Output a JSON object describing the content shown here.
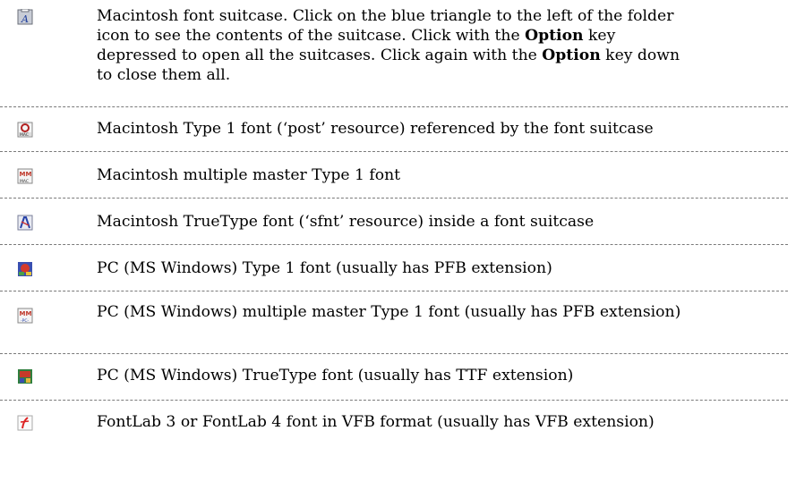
{
  "rows": [
    {
      "icon": "font-suitcase-icon",
      "text_parts": [
        {
          "t": "Macintosh font suitcase. Click on the blue triangle to the left of the folder icon to see the contents of the suitcase. Click with the "
        },
        {
          "t": "Option",
          "bold": true
        },
        {
          "t": " key depressed to open all the suitcases. Click again with the "
        },
        {
          "t": "Option",
          "bold": true
        },
        {
          "t": " key down to close them all."
        }
      ]
    },
    {
      "icon": "mac-type1-font-icon",
      "text": "Macintosh Type 1 font (‘post’ resource) referenced by the font suitcase"
    },
    {
      "icon": "mac-multiple-master-font-icon",
      "text": "Macintosh multiple master Type 1 font"
    },
    {
      "icon": "mac-truetype-font-icon",
      "text": "Macintosh TrueType font (‘sfnt’ resource) inside a font suitcase"
    },
    {
      "icon": "pc-type1-font-icon",
      "text": "PC (MS Windows) Type 1 font (usually has PFB extension)"
    },
    {
      "icon": "pc-multiple-master-font-icon",
      "text": "PC (MS Windows) multiple master Type 1 font (usually has PFB extension)"
    },
    {
      "icon": "pc-truetype-font-icon",
      "text": "PC (MS Windows) TrueType font (usually has TTF extension)"
    },
    {
      "icon": "fontlab-vfb-font-icon",
      "text": "FontLab 3 or FontLab 4  font in VFB format (usually has VFB extension)"
    }
  ]
}
